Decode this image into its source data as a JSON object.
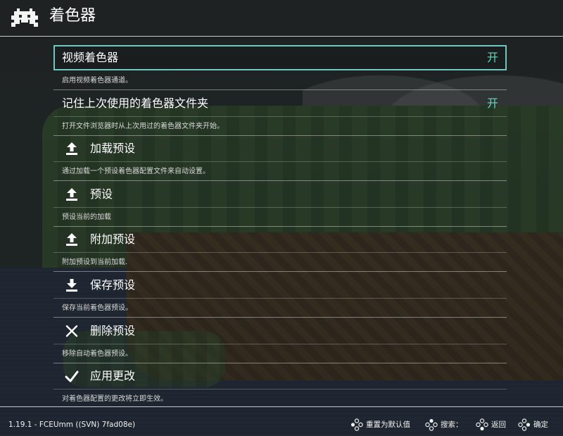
{
  "header": {
    "title": "着色器"
  },
  "entries": [
    {
      "label": "视频着色器",
      "value": "开",
      "desc": "启用视频着色器通道。"
    },
    {
      "label": "记住上次使用的着色器文件夹",
      "value": "开",
      "desc": "打开文件浏览器时从上次用过的着色器文件夹开始。"
    },
    {
      "label": "加载预设",
      "icon": "upload-icon",
      "desc": "通过加载一个预设着色器配置文件来自动设置。"
    },
    {
      "label": "预设",
      "icon": "upload-icon",
      "desc": "预设当前的加载"
    },
    {
      "label": "附加预设",
      "icon": "upload-icon",
      "desc": "附加预设到当前加载."
    },
    {
      "label": "保存预设",
      "icon": "download-icon",
      "desc": "保存当前着色器预设。"
    },
    {
      "label": "删除预设",
      "icon": "close-icon",
      "desc": "移除自动着色器预设。"
    },
    {
      "label": "应用更改",
      "icon": "checkmark-icon",
      "desc": "对着色器配置的更改将立即生效。"
    }
  ],
  "footer": {
    "version": "1.19.1 - FCEUmm ((SVN) 7fad08e)",
    "hints": [
      {
        "icon": "gamepad-buttons-icon",
        "label": "重置为默认值"
      },
      {
        "icon": "gamepad-buttons-icon",
        "label": "搜索："
      },
      {
        "icon": "gamepad-buttons-icon",
        "label": "返回"
      },
      {
        "icon": "gamepad-buttons-icon",
        "label": "确定"
      }
    ]
  },
  "colors": {
    "accent": "#66d5bd",
    "selection_border": "#6ec8c0"
  }
}
